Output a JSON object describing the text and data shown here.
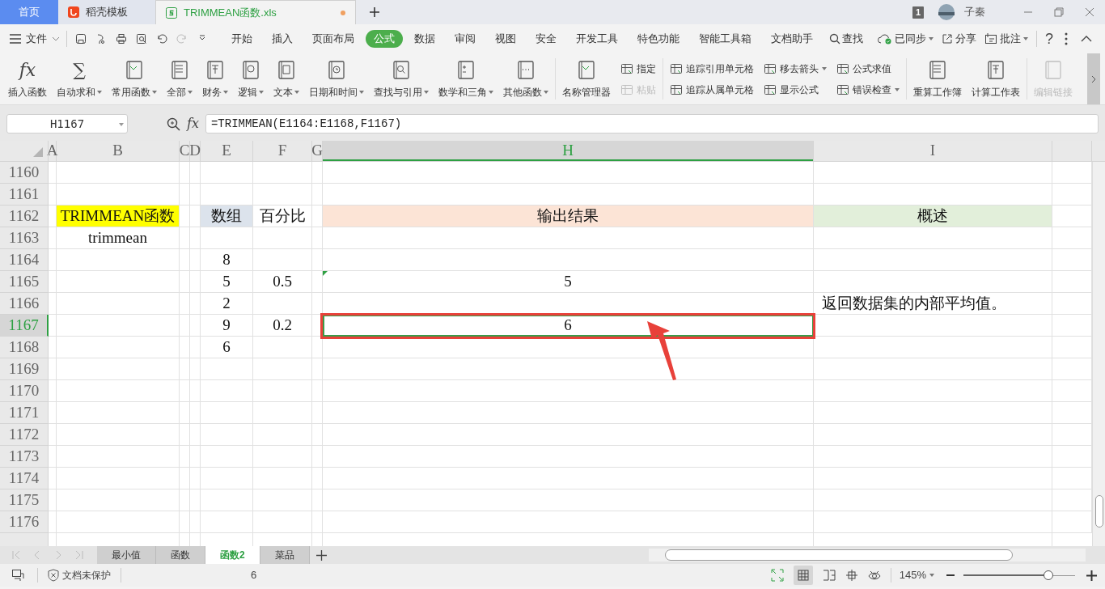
{
  "title_tabs": [
    {
      "label": "首页",
      "kind": "home",
      "selected": false
    },
    {
      "label": "稻壳模板",
      "kind": "template",
      "selected": false
    },
    {
      "label": "TRIMMEAN函数.xls",
      "kind": "document",
      "selected": true,
      "unsaved": true
    }
  ],
  "title_right": {
    "badge": "1",
    "user": "子秦"
  },
  "menu": {
    "file": "文件",
    "tabs": [
      {
        "label": "开始",
        "selected": false
      },
      {
        "label": "插入",
        "selected": false
      },
      {
        "label": "页面布局",
        "selected": false
      },
      {
        "label": "公式",
        "selected": true
      },
      {
        "label": "数据",
        "selected": false
      },
      {
        "label": "审阅",
        "selected": false
      },
      {
        "label": "视图",
        "selected": false
      },
      {
        "label": "安全",
        "selected": false
      },
      {
        "label": "开发工具",
        "selected": false
      },
      {
        "label": "特色功能",
        "selected": false
      },
      {
        "label": "智能工具箱",
        "selected": false
      },
      {
        "label": "文档助手",
        "selected": false
      }
    ],
    "search": "查找",
    "sync": "已同步",
    "share": "分享",
    "comment": "批注",
    "help": "?"
  },
  "ribbon": [
    [
      [
        {
          "label": "插入函数",
          "icon_text": "fx",
          "dropdown": false,
          "disabled": false
        }
      ],
      [
        {
          "label": "自动求和",
          "icon_text": "∑",
          "dropdown": true,
          "disabled": false
        }
      ],
      [
        {
          "label": "常用函数",
          "dropdown": true,
          "disabled": false
        }
      ],
      [
        {
          "label": "全部",
          "dropdown": true,
          "disabled": false
        }
      ],
      [
        {
          "label": "财务",
          "dropdown": true,
          "disabled": false
        }
      ],
      [
        {
          "label": "逻辑",
          "dropdown": true,
          "disabled": false
        }
      ],
      [
        {
          "label": "文本",
          "dropdown": true,
          "disabled": false
        }
      ],
      [
        {
          "label": "日期和时间",
          "dropdown": true,
          "disabled": false
        }
      ],
      [
        {
          "label": "查找与引用",
          "dropdown": true,
          "disabled": false
        }
      ],
      [
        {
          "label": "数学和三角",
          "dropdown": true,
          "disabled": false
        }
      ],
      [
        {
          "label": "其他函数",
          "dropdown": true,
          "disabled": false
        }
      ]
    ],
    [
      [
        {
          "label": "名称管理器",
          "dropdown": false,
          "disabled": false
        }
      ],
      [
        {
          "label": "指定",
          "dropdown": false,
          "disabled": false
        },
        {
          "label": "粘贴",
          "dropdown": false,
          "disabled": true
        }
      ]
    ],
    [
      [
        {
          "label": "追踪引用单元格",
          "dropdown": false,
          "disabled": false
        },
        {
          "label": "追踪从属单元格",
          "dropdown": false,
          "disabled": false
        }
      ],
      [
        {
          "label": "移去箭头",
          "dropdown": true,
          "disabled": false
        },
        {
          "label": "显示公式",
          "dropdown": false,
          "disabled": false
        }
      ],
      [
        {
          "label": "公式求值",
          "dropdown": false,
          "disabled": false
        },
        {
          "label": "错误检查",
          "dropdown": true,
          "disabled": false
        }
      ]
    ],
    [
      [
        {
          "label": "重算工作簿",
          "dropdown": false,
          "disabled": false
        }
      ],
      [
        {
          "label": "计算工作表",
          "dropdown": false,
          "disabled": false
        }
      ]
    ],
    [
      [
        {
          "label": "编辑链接",
          "dropdown": false,
          "disabled": true
        }
      ]
    ]
  ],
  "formula_bar": {
    "name_box": "H1167",
    "fx": "fx",
    "formula": "=TRIMMEAN(E1164:E1168,F1167)"
  },
  "sheet": {
    "columns": [
      {
        "label": "A",
        "selected": false
      },
      {
        "label": "B",
        "selected": false
      },
      {
        "label": "C",
        "selected": false
      },
      {
        "label": "D",
        "selected": false
      },
      {
        "label": "E",
        "selected": false
      },
      {
        "label": "F",
        "selected": false
      },
      {
        "label": "G",
        "selected": false
      },
      {
        "label": "H",
        "selected": true
      },
      {
        "label": "I",
        "selected": false
      }
    ],
    "rows": [
      {
        "number": "1160",
        "selected": false,
        "cells": [
          {},
          {},
          {},
          {},
          {},
          {},
          {},
          {},
          {}
        ]
      },
      {
        "number": "1161",
        "selected": false,
        "cells": [
          {},
          {},
          {},
          {},
          {},
          {},
          {},
          {},
          {}
        ]
      },
      {
        "number": "1162",
        "selected": false,
        "cells": [
          {},
          {
            "text": "TRIMMEAN函数",
            "color": "#ffff00"
          },
          {},
          {},
          {
            "text": "数组",
            "color": "#dce3ec"
          },
          {
            "text": "百分比"
          },
          {},
          {
            "text": "输出结果",
            "color": "#fce4d6"
          },
          {
            "text": "概述",
            "color": "#e2efda"
          }
        ]
      },
      {
        "number": "1163",
        "selected": false,
        "cells": [
          {},
          {
            "text": "trimmean"
          },
          {},
          {},
          {},
          {},
          {},
          {},
          {}
        ]
      },
      {
        "number": "1164",
        "selected": false,
        "cells": [
          {},
          {},
          {},
          {},
          {
            "text": "8"
          },
          {},
          {},
          {},
          {}
        ]
      },
      {
        "number": "1165",
        "selected": false,
        "cells": [
          {},
          {},
          {},
          {},
          {
            "text": "5"
          },
          {
            "text": "0.5"
          },
          {},
          {
            "text": "5",
            "flag": true
          },
          {}
        ]
      },
      {
        "number": "1166",
        "selected": false,
        "cells": [
          {},
          {},
          {},
          {},
          {
            "text": "2"
          },
          {},
          {},
          {},
          {
            "text": "返回数据集的内部平均值。"
          }
        ]
      },
      {
        "number": "1167",
        "selected": true,
        "cells": [
          {},
          {},
          {},
          {},
          {
            "text": "9"
          },
          {
            "text": "0.2"
          },
          {},
          {
            "text": "6",
            "selected": true
          },
          {}
        ]
      },
      {
        "number": "1168",
        "selected": false,
        "cells": [
          {},
          {},
          {},
          {},
          {
            "text": "6"
          },
          {},
          {},
          {},
          {}
        ]
      },
      {
        "number": "1169",
        "selected": false,
        "cells": [
          {},
          {},
          {},
          {},
          {},
          {},
          {},
          {},
          {}
        ]
      },
      {
        "number": "1170",
        "selected": false,
        "cells": [
          {},
          {},
          {},
          {},
          {},
          {},
          {},
          {},
          {}
        ]
      },
      {
        "number": "1171",
        "selected": false,
        "cells": [
          {},
          {},
          {},
          {},
          {},
          {},
          {},
          {},
          {}
        ]
      },
      {
        "number": "1172",
        "selected": false,
        "cells": [
          {},
          {},
          {},
          {},
          {},
          {},
          {},
          {},
          {}
        ]
      },
      {
        "number": "1173",
        "selected": false,
        "cells": [
          {},
          {},
          {},
          {},
          {},
          {},
          {},
          {},
          {}
        ]
      },
      {
        "number": "1174",
        "selected": false,
        "cells": [
          {},
          {},
          {},
          {},
          {},
          {},
          {},
          {},
          {}
        ]
      },
      {
        "number": "1175",
        "selected": false,
        "cells": [
          {},
          {},
          {},
          {},
          {},
          {},
          {},
          {},
          {}
        ]
      },
      {
        "number": "1176",
        "selected": false,
        "cells": [
          {},
          {},
          {},
          {},
          {},
          {},
          {},
          {},
          {}
        ]
      }
    ]
  },
  "sheet_tabs": [
    {
      "label": "最小值",
      "selected": false
    },
    {
      "label": "函数",
      "selected": false
    },
    {
      "label": "函数2",
      "selected": true
    },
    {
      "label": "菜品",
      "selected": false
    }
  ],
  "status_bar": {
    "protection": "文档未保护",
    "summary": "6",
    "zoom": "145%",
    "zoom_slider": {
      "level": 0.76
    }
  }
}
